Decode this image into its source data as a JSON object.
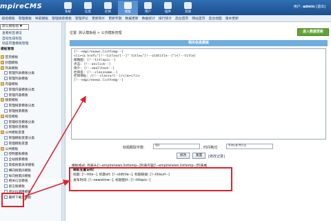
{
  "app": {
    "logo": "mpireCMS",
    "user_label": "用户:",
    "user_name": "admin",
    "logout": "[退出]"
  },
  "top_icons": [
    {
      "label": "系统",
      "icon": "computer-icon"
    },
    {
      "label": "信息",
      "icon": "document-icon"
    },
    {
      "label": "栏目",
      "icon": "folder-icon"
    },
    {
      "label": "模板",
      "icon": "template-icon",
      "active": true
    },
    {
      "label": "用户",
      "icon": "user-icon"
    },
    {
      "label": "插件",
      "icon": "plugin-icon"
    },
    {
      "label": "其他",
      "icon": "other-icon"
    }
  ],
  "menubar": [
    "级组模板",
    "管理模板",
    "导航模板",
    "管理搜索模板",
    "管理评论",
    "更新碎片",
    "更新专题",
    "数据更新",
    "数据统计",
    "排行统计",
    "后台首页",
    "网站首页",
    "后台地图",
    "版本更新"
  ],
  "sidebar": {
    "select_value": "默认模板组 ▼",
    "links": [
      "查看标签语法",
      "自动生成标签",
      "动态页面模板管理"
    ],
    "tree_title": "模板管理",
    "tree": [
      {
        "label": "首页模板",
        "level": 0,
        "folder": true
      },
      {
        "label": "封面模板",
        "level": 0,
        "folder": true
      },
      {
        "label": "列表模板",
        "level": 0,
        "folder": true
      },
      {
        "label": "管理列表模板分类",
        "level": 1,
        "folder": false
      },
      {
        "label": "管理列表模板",
        "level": 1,
        "folder": false
      },
      {
        "label": "内容模板",
        "level": 0,
        "folder": true
      },
      {
        "label": "管理内容模板分类",
        "level": 1,
        "folder": false
      },
      {
        "label": "管理内容模板",
        "level": 1,
        "folder": false
      },
      {
        "label": "搜索模板",
        "level": 0,
        "folder": true
      },
      {
        "label": "管理搜索模板分类",
        "level": 1,
        "folder": false
      },
      {
        "label": "管理搜索模板",
        "level": 1,
        "folder": false
      },
      {
        "label": "标签模板",
        "level": 0,
        "folder": true
      },
      {
        "label": "管理标签模板分类",
        "level": 1,
        "folder": false
      },
      {
        "label": "管理标签模板",
        "level": 1,
        "folder": false
      },
      {
        "label": "公共模板变量",
        "level": 0,
        "folder": true
      },
      {
        "label": "管理模板变量分类",
        "level": 1,
        "folder": false
      },
      {
        "label": "管理模板变量",
        "level": 1,
        "folder": false
      },
      {
        "label": "公共模板",
        "level": 0,
        "folder": true
      },
      {
        "label": "控制面板模板",
        "level": 1,
        "folder": false
      },
      {
        "label": "全站搜索模板",
        "level": 1,
        "folder": false
      },
      {
        "label": "高级搜索表单模板",
        "level": 1,
        "folder": false
      },
      {
        "label": "横向搜索JS模板",
        "level": 1,
        "folder": false
      },
      {
        "label": "纵向搜索JS模板",
        "level": 1,
        "folder": false
      },
      {
        "label": "相关信息模板",
        "level": 1,
        "folder": false,
        "highlight": true
      },
      {
        "label": "留言板模板",
        "level": 1,
        "folder": false
      },
      {
        "label": "评论JS调用模板",
        "level": 1,
        "folder": false
      },
      {
        "label": "最终下载页模板",
        "level": 1,
        "folder": false
      }
    ]
  },
  "main": {
    "breadcrumb": "位置: 默认模板组 > 公共模板管理",
    "add_button": "进入数据更新",
    "panel_title": "相关信息模板",
    "template_text": "[!--empirenews.listtemp--]\n<li><a href=\"[!--titleurl--]\" title=\"[!--oldtitle--]\">[!--title]\n缩略图: [!--titlepic--]\n点击: [!--onclick--]\n简介: [!--smalltext--]\n栏目名: [!--classname--]\n栏目地址: /[!--classurl--]/</a></li>\n[!--empirenews.listtemp--]",
    "title_len_label": "标题截取字数:",
    "title_len_value": "50",
    "time_format_label": ", 时间格式:",
    "time_format_value": "Y-m-d H:i:s",
    "submit": "修改",
    "reset": "重置",
    "restore": "[修改记录]",
    "var_format_line": "模板格式: 列表头[!--empirenews.listtemp--]列表内容[!--empirenews.listtemp--]列表尾",
    "var_title": "模板变量说明:",
    "var_line1": "标题: [!--title--], 标题alt: [!--oldtitle--], 标题链接: [!--titleurl--]",
    "var_line2": "发布时间: [!--newstime--], 标题图片: [!--titlepic--]"
  },
  "colors": {
    "topbar": "#1c4f8c",
    "highlight": "#e0202a",
    "panel": "#6eaedd",
    "add_button": "#63a534"
  }
}
